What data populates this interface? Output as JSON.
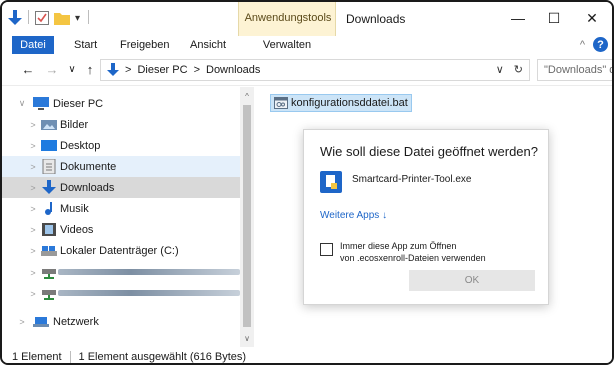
{
  "window": {
    "title": "Downloads",
    "context_tab": "Anwendungstools",
    "minimize_symbol": "—",
    "maximize_symbol": "☐",
    "close_symbol": "✕"
  },
  "ribbon": {
    "tabs": [
      "Datei",
      "Start",
      "Freigeben",
      "Ansicht"
    ],
    "context_sub": "Verwalten",
    "collapse_symbol": "^",
    "help_symbol": "?"
  },
  "address": {
    "back": "←",
    "forward": "→",
    "recent": "∨",
    "up": "↑",
    "crumbs": [
      "Dieser PC",
      "Downloads"
    ],
    "crumb_sep": ">",
    "dropdown": "∨",
    "refresh": "↻",
    "search_placeholder": "\"Downloads\" d"
  },
  "nav": {
    "items": [
      {
        "label": "Dieser PC",
        "icon": "computer-icon",
        "chevron": "∨"
      },
      {
        "label": "Bilder",
        "icon": "pictures-folder-icon",
        "chevron": ">"
      },
      {
        "label": "Desktop",
        "icon": "desktop-folder-icon",
        "chevron": ">"
      },
      {
        "label": "Dokumente",
        "icon": "documents-folder-icon",
        "chevron": ">"
      },
      {
        "label": "Downloads",
        "icon": "downloads-folder-icon",
        "chevron": ">"
      },
      {
        "label": "Musik",
        "icon": "music-folder-icon",
        "chevron": ">"
      },
      {
        "label": "Videos",
        "icon": "videos-folder-icon",
        "chevron": ">"
      },
      {
        "label": "Lokaler Datenträger (C:)",
        "icon": "drive-icon",
        "chevron": ">"
      },
      {
        "label": "",
        "icon": "network-drive-icon",
        "chevron": ">"
      },
      {
        "label": "",
        "icon": "network-drive-icon",
        "chevron": ">"
      },
      {
        "label": "Netzwerk",
        "icon": "network-icon",
        "chevron": ">"
      }
    ],
    "scroll_up": "^",
    "scroll_down": "∨"
  },
  "content": {
    "file_name": "konfigurationsddatei.bat"
  },
  "dialog": {
    "title": "Wie soll diese Datei geöffnet werden?",
    "app_name": "Smartcard-Printer-Tool.exe",
    "more_apps": "Weitere Apps ↓",
    "checkbox_label_line1": "Immer diese App zum Öffnen",
    "checkbox_label_line2": "von .ecosxenroll-Dateien verwenden",
    "ok_label": "OK"
  },
  "status": {
    "count": "1 Element",
    "selection": "1 Element ausgewählt (616 Bytes)"
  },
  "colors": {
    "accent": "#1e66c8",
    "selection": "#d9d9d9",
    "context_tab": "#fdf3d4"
  }
}
